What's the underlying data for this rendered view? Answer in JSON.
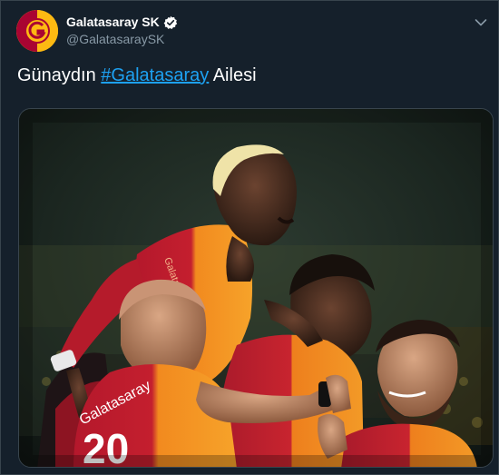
{
  "account": {
    "display_name": "Galatasaray SK",
    "handle": "@GalatasaraySK",
    "verified": true,
    "avatar_icon": "galatasaray-crest-icon"
  },
  "tweet": {
    "text_before": "Günaydın ",
    "hashtag": "#Galatasaray",
    "text_after": " Ailesi"
  },
  "media": {
    "jersey_number": "20",
    "jersey_text": "Galatasaray"
  },
  "colors": {
    "background": "#15202b",
    "border": "#38444d",
    "link": "#1da1f2",
    "secondary_text": "#8899a6",
    "brand_red": "#a90432",
    "brand_yellow": "#fdb912"
  },
  "icons": {
    "verified": "verified-badge-icon",
    "menu": "chevron-down-icon"
  }
}
